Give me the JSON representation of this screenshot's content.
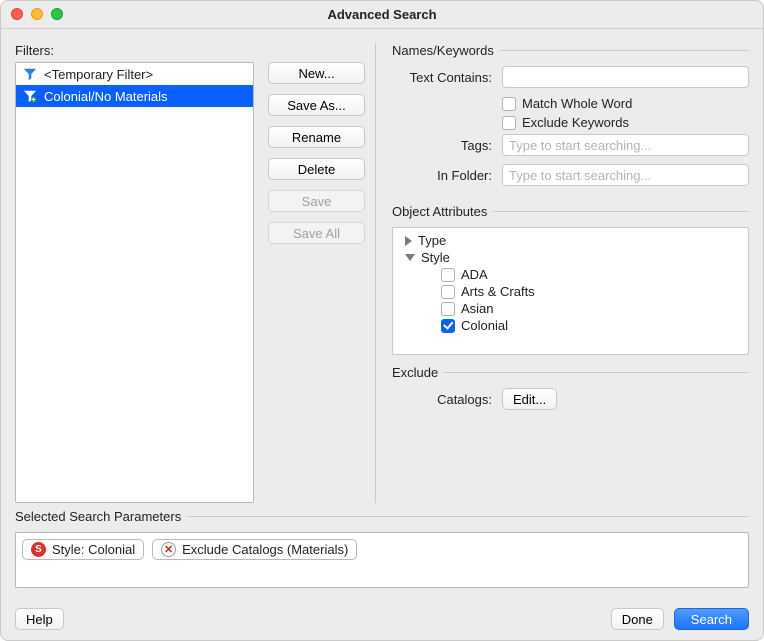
{
  "window": {
    "title": "Advanced Search"
  },
  "filters": {
    "label": "Filters:",
    "items": [
      {
        "label": "<Temporary Filter>",
        "selected": false
      },
      {
        "label": "Colonial/No Materials",
        "selected": true
      }
    ],
    "buttons": {
      "new": "New...",
      "save_as": "Save As...",
      "rename": "Rename",
      "delete": "Delete",
      "save": "Save",
      "save_all": "Save All"
    }
  },
  "names_keywords": {
    "legend": "Names/Keywords",
    "text_contains_label": "Text Contains:",
    "text_contains_value": "",
    "match_whole_word": {
      "label": "Match Whole Word",
      "checked": false
    },
    "exclude_keywords": {
      "label": "Exclude Keywords",
      "checked": false
    },
    "tags": {
      "label": "Tags:",
      "placeholder": "Type to start searching...",
      "value": ""
    },
    "in_folder": {
      "label": "In Folder:",
      "placeholder": "Type to start searching...",
      "value": ""
    }
  },
  "object_attributes": {
    "legend": "Object Attributes",
    "tree": {
      "type": {
        "label": "Type",
        "expanded": false
      },
      "style": {
        "label": "Style",
        "expanded": true,
        "options": [
          {
            "label": "ADA",
            "checked": false
          },
          {
            "label": "Arts & Crafts",
            "checked": false
          },
          {
            "label": "Asian",
            "checked": false
          },
          {
            "label": "Colonial",
            "checked": true
          }
        ]
      }
    }
  },
  "exclude": {
    "legend": "Exclude",
    "catalogs_label": "Catalogs:",
    "edit_button": "Edit..."
  },
  "selected_params": {
    "label": "Selected Search Parameters",
    "pills": [
      {
        "icon": "S",
        "text": "Style: Colonial"
      },
      {
        "icon": "X",
        "text": "Exclude Catalogs (Materials)"
      }
    ]
  },
  "footer": {
    "help": "Help",
    "done": "Done",
    "search": "Search"
  }
}
